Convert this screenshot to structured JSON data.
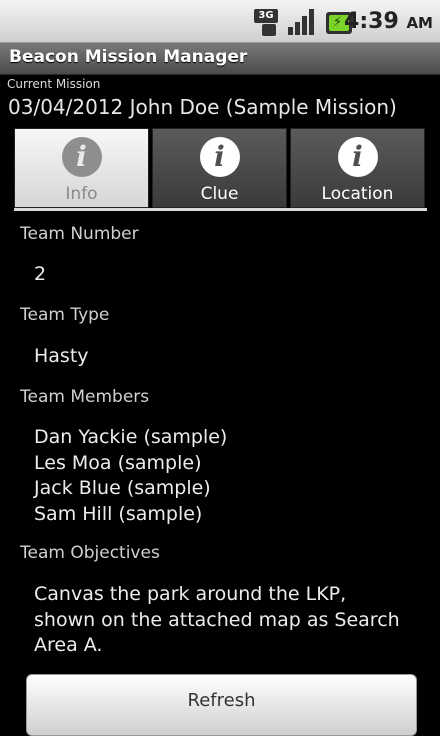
{
  "status_bar": {
    "network_type": "3G",
    "time": "4:39",
    "ampm": "AM"
  },
  "app": {
    "title": "Beacon Mission Manager"
  },
  "mission": {
    "label": "Current Mission",
    "name": "03/04/2012 John Doe (Sample Mission)"
  },
  "tabs": [
    {
      "label": "Info",
      "icon": "info-icon",
      "selected": true
    },
    {
      "label": "Clue",
      "icon": "info-icon",
      "selected": false
    },
    {
      "label": "Location",
      "icon": "info-icon",
      "selected": false
    }
  ],
  "info": {
    "team_number_label": "Team Number",
    "team_number": "2",
    "team_type_label": "Team Type",
    "team_type": "Hasty",
    "team_members_label": "Team Members",
    "team_members": [
      "Dan Yackie (sample)",
      "Les Moa (sample)",
      "Jack Blue (sample)",
      "Sam Hill (sample)"
    ],
    "objectives_label": "Team Objectives",
    "objectives_lines": [
      "Canvas the park around the LKP,",
      "shown on the attached map as Search",
      "Area A."
    ]
  },
  "refresh_label": "Refresh"
}
